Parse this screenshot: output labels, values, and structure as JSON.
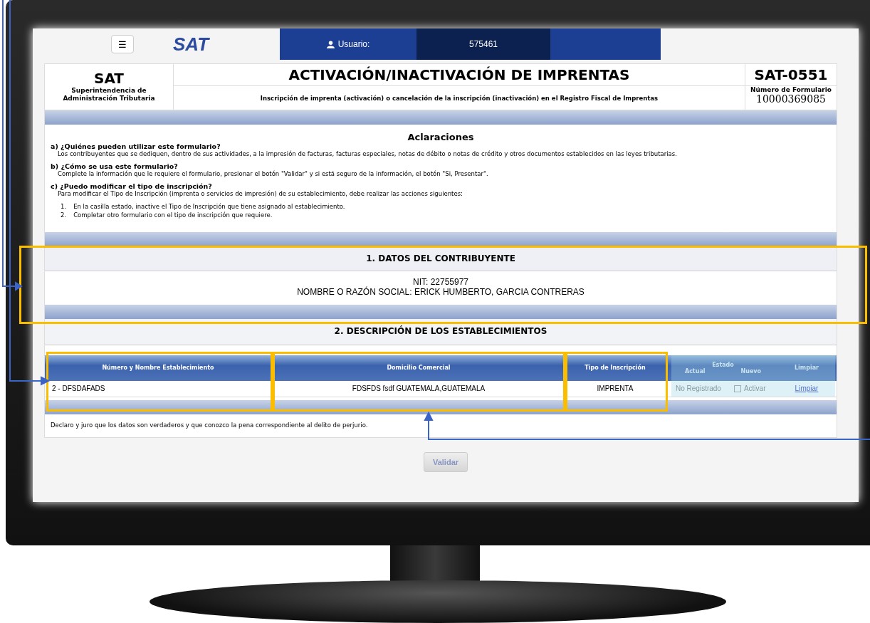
{
  "nav": {
    "menu_icon": "☰",
    "logo": "SAT",
    "user_label": "Usuario:",
    "user_id": "575461"
  },
  "header": {
    "org": "SAT",
    "org_name": "Superintendencia de Administración Tributaria",
    "title": "ACTIVACIÓN/INACTIVACIÓN DE IMPRENTAS",
    "subtitle": "Inscripción de imprenta (activación) o cancelación de la inscripción (inactivación) en el Registro Fiscal de Imprentas",
    "form_code": "SAT-0551",
    "form_number_label": "Número de Formulario",
    "form_number": "10000369085"
  },
  "clarifications": {
    "title": "Aclaraciones",
    "items": [
      {
        "question": "a) ¿Quiénes pueden utilizar este formulario?",
        "answer": "Los contribuyentes que se dediquen, dentro de sus actividades, a la impresión de facturas, facturas especiales, notas de débito o notas de crédito y otros documentos establecidos en las leyes tributarias."
      },
      {
        "question": "b) ¿Cómo se usa este formulario?",
        "answer": "Complete la información que le requiere el formulario, presionar el botón \"Validar\" y si está seguro de la información, el botón \"Si, Presentar\"."
      },
      {
        "question": "c) ¿Puedo modificar el tipo de inscripción?",
        "answer": "Para modificar el Tipo de Inscripción (imprenta o servicios de impresión) de su establecimiento, debe realizar las acciones siguientes:",
        "steps": [
          "1.",
          "2."
        ],
        "step_texts": [
          "En la casilla estado, inactive el Tipo de Inscripción que tiene asignado al establecimiento.",
          "Completar otro formulario con el tipo de inscripción que requiere."
        ]
      }
    ]
  },
  "taxpayer": {
    "title": "1. DATOS DEL CONTRIBUYENTE",
    "nit": "NIT: 22755977",
    "name": "NOMBRE O RAZÓN SOCIAL: ERICK HUMBERTO, GARCIA CONTRERAS"
  },
  "establishments": {
    "title": "2. DESCRIPCIÓN DE LOS ESTABLECIMIENTOS",
    "columns": [
      "Número y Nombre Establecimiento",
      "Domicilio Comercial",
      "Tipo de Inscripción",
      "Estado",
      "Limpiar"
    ],
    "subcolumns": [
      "Actual",
      "Nuevo"
    ],
    "rows": [
      {
        "establishment": "2 - DFSDAFADS",
        "address": "FDSFDS fsdf GUATEMALA,GUATEMALA",
        "type": "IMPRENTA",
        "current": "No Registrado",
        "new_label": "Activar",
        "checked": false,
        "clear": "Limpiar"
      }
    ]
  },
  "declaration": "Declaro y juro que los datos son verdaderos y que conozco la pena correspondiente al delito de perjurio.",
  "validate_button": {
    "label": "Validar",
    "disabled": true
  }
}
